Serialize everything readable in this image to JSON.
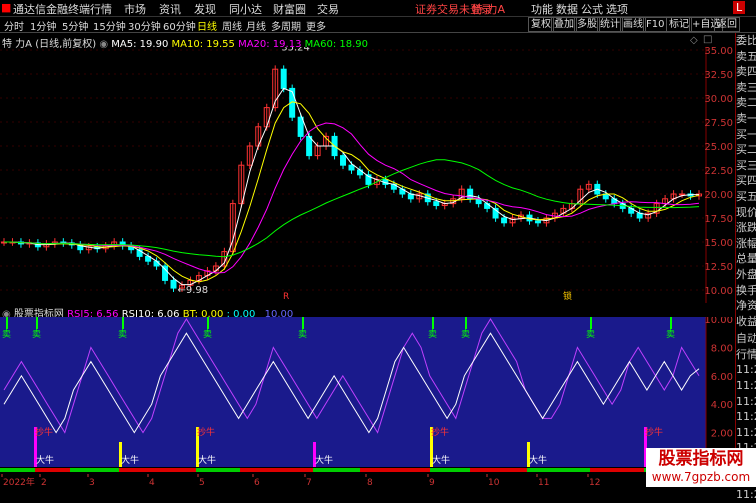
{
  "app": {
    "title": "通达信金融终端",
    "logo_text": "L"
  },
  "menu": {
    "items": [
      "行情",
      "市场",
      "资讯",
      "发现",
      "同小达",
      "财富圈",
      "交易"
    ],
    "login_status": "证券交易未登录",
    "stock_name": "特 力A",
    "right_items": [
      "功能",
      "数据",
      "公式",
      "选项"
    ]
  },
  "timeframes": {
    "items": [
      "分时",
      "1分钟",
      "5分钟",
      "15分钟",
      "30分钟",
      "60分钟",
      "日线",
      "周线",
      "月线",
      "多周期",
      "更多"
    ],
    "active": "日线"
  },
  "toolbar": {
    "buttons": [
      "复权",
      "叠加",
      "多股",
      "统计",
      "画线",
      "F10",
      "标记",
      "+自选",
      "返回"
    ]
  },
  "main_chart": {
    "stock_label": "特 力A (日线,前复权)",
    "ma5_label": "MA5: 19.90",
    "ma10_label": "MA10: 19.55",
    "ma20_label": "MA20: 19.13",
    "ma60_label": "MA60: 18.90",
    "high_label": "35.24",
    "low_label": "9.98",
    "marker_r": "R",
    "marker_lock": "锁",
    "y_ticks": [
      "35.00",
      "32.50",
      "30.00",
      "27.50",
      "25.00",
      "22.50",
      "20.00",
      "17.50",
      "15.00",
      "12.50",
      "10.00"
    ]
  },
  "indicator": {
    "name": "股票指标网",
    "rsi5_label": "RSI5: 6.56",
    "rsi10_label": "RSI10: 6.06",
    "bt_label": "BT: 0.00",
    "zero_label": ": 0.00",
    "ten_label": "10.00",
    "y_ticks": [
      "10.00",
      "8.00",
      "6.00",
      "4.00",
      "2.00"
    ],
    "signal_top": "卖",
    "signal_mid": "抄牛",
    "signal_bottom": "大牛"
  },
  "x_axis": {
    "labels": [
      "2022年",
      "2",
      "3",
      "4",
      "5",
      "6",
      "7",
      "8",
      "9",
      "10",
      "11",
      "12",
      "1"
    ]
  },
  "right_panel": {
    "labels": [
      "委比",
      "卖五",
      "卖四",
      "卖三",
      "卖二",
      "卖一",
      "买一",
      "买二",
      "买三",
      "买四",
      "买五",
      "现价",
      "涨跌",
      "涨幅",
      "总量",
      "外盘",
      "换手",
      "净资",
      "收益"
    ],
    "lower_labels": [
      "自动",
      "行情",
      "11:26",
      "11:26",
      "11:26",
      "11:26",
      "11:26",
      "11:26",
      "11:26",
      "11:26",
      "11:26"
    ]
  },
  "watermark": {
    "line1": "股票指标网",
    "line2": "www.7gpzb.com"
  },
  "chart_data": {
    "type": "candlestick",
    "price_range": [
      10,
      35.24
    ],
    "ma_names": [
      "MA5",
      "MA10",
      "MA20",
      "MA60"
    ],
    "ma_colors": [
      "#ffffff",
      "#ffff00",
      "#ff00ff",
      "#00ff00"
    ],
    "price_points": [
      15,
      15,
      14.8,
      14.9,
      14.5,
      14.8,
      15,
      14.9,
      14.7,
      14.2,
      14.5,
      14.3,
      14.6,
      15,
      14.6,
      14.2,
      13.5,
      13,
      12.5,
      11,
      10.2,
      10.5,
      11,
      11.5,
      12,
      12.5,
      14,
      19,
      23,
      25,
      27,
      29,
      33,
      31,
      28,
      26,
      24,
      25,
      26,
      24,
      23,
      22.5,
      22,
      21,
      21.5,
      21,
      20.5,
      20,
      19.5,
      20,
      19.2,
      18.8,
      19,
      19.5,
      20.5,
      19.5,
      19,
      18.5,
      17.5,
      17,
      17.5,
      17.8,
      17.2,
      17,
      17.5,
      18,
      18.5,
      19,
      20.5,
      21,
      20,
      19.5,
      19,
      18.5,
      18,
      17.5,
      18,
      19,
      19.5,
      20,
      20,
      19.8,
      20
    ],
    "rsi_range": [
      0,
      10
    ],
    "rsi_series": [
      4,
      5,
      6,
      5,
      4,
      3,
      2,
      3,
      5,
      6,
      7,
      6,
      5,
      4,
      3,
      2,
      3,
      4,
      6,
      7,
      8,
      9,
      8,
      7,
      6,
      5,
      4,
      3,
      4,
      5,
      6,
      7,
      6,
      5,
      4,
      3,
      4,
      5,
      6,
      5,
      4,
      3,
      2,
      3,
      5,
      7,
      8,
      7,
      6,
      5,
      4,
      3,
      4,
      6,
      7,
      8,
      9,
      8,
      7,
      6,
      5,
      4,
      3,
      4,
      5,
      6,
      7,
      6,
      5,
      4,
      5,
      6,
      7,
      6,
      5,
      6,
      7,
      6,
      5,
      6,
      6.5
    ],
    "rsi2_series": [
      5,
      6,
      7,
      6,
      5,
      4,
      3,
      2,
      4,
      6,
      8,
      7,
      6,
      5,
      4,
      3,
      2,
      3,
      5,
      7,
      9,
      10,
      9,
      8,
      7,
      6,
      5,
      4,
      3,
      4,
      6,
      8,
      7,
      6,
      5,
      4,
      3,
      4,
      5,
      6,
      5,
      4,
      3,
      2,
      4,
      6,
      8,
      9,
      8,
      6,
      5,
      4,
      3,
      5,
      7,
      9,
      10,
      9,
      8,
      7,
      5,
      4,
      3,
      3,
      4,
      6,
      8,
      7,
      6,
      5,
      4,
      5,
      7,
      8,
      7,
      6,
      5,
      6,
      8,
      7,
      6
    ]
  }
}
